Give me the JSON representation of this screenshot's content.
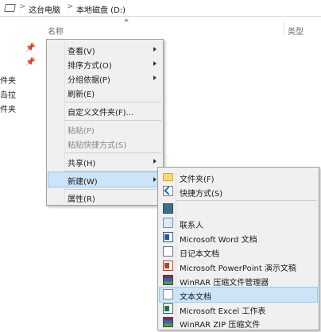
{
  "address_bar": {
    "crumbs": [
      "这台电脑",
      "本地磁盘 (D:)"
    ],
    "separator": ">"
  },
  "columns": {
    "name": "名称",
    "type": "类型"
  },
  "quick_access": [
    "件夹",
    "岛拉",
    "件夹"
  ],
  "context_menu": {
    "items": [
      {
        "label": "查看(V)",
        "has_submenu": true
      },
      {
        "label": "排序方式(O)",
        "has_submenu": true
      },
      {
        "label": "分组依据(P)",
        "has_submenu": true
      },
      {
        "label": "刷新(E)"
      },
      {
        "label": "自定义文件夹(F)..."
      },
      {
        "label": "粘贴(P)",
        "disabled": true
      },
      {
        "label": "粘贴快捷方式(S)",
        "disabled": true
      },
      {
        "label": "共享(H)",
        "has_submenu": true
      },
      {
        "label": "新建(W)",
        "has_submenu": true,
        "highlighted": true
      },
      {
        "label": "属性(R)"
      }
    ]
  },
  "new_submenu": {
    "items": [
      {
        "label": "文件夹(F)",
        "icon": "folder-icon"
      },
      {
        "label": "快捷方式(S)",
        "icon": "shortcut-icon"
      },
      {
        "label": "",
        "icon": "briefcase-icon"
      },
      {
        "label": "联系人",
        "icon": "contact-icon"
      },
      {
        "label": "Microsoft Word 文档",
        "icon": "word-doc-icon"
      },
      {
        "label": "日记本文档",
        "icon": "journal-icon"
      },
      {
        "label": "Microsoft PowerPoint 演示文稿",
        "icon": "powerpoint-icon"
      },
      {
        "label": "WinRAR 压缩文件管理器",
        "icon": "winrar-icon"
      },
      {
        "label": "文本文档",
        "icon": "text-doc-icon",
        "highlighted": true
      },
      {
        "label": "Microsoft Excel 工作表",
        "icon": "excel-icon"
      },
      {
        "label": "WinRAR ZIP 压缩文件",
        "icon": "winrar-zip-icon"
      }
    ]
  },
  "colors": {
    "menu_bg": "#f0f0f0",
    "highlight_bg": "#cce4f7",
    "highlight_border": "#99c9ef",
    "disabled_text": "#8a8a8a"
  }
}
